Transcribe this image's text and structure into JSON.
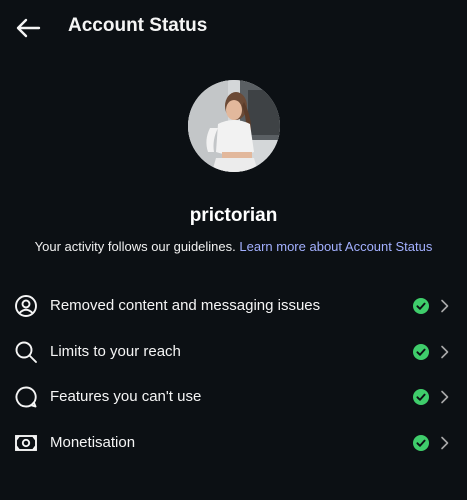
{
  "header": {
    "title": "Account Status",
    "back_icon": "arrow-left-icon"
  },
  "profile": {
    "username": "prictorian",
    "info_text": "Your activity follows our guidelines.",
    "learn_more_link": "Learn more about Account Status"
  },
  "items": [
    {
      "label": "Removed content and messaging issues",
      "icon": "person-circle-icon",
      "status": "ok"
    },
    {
      "label": "Limits to your reach",
      "icon": "magnifier-icon",
      "status": "ok"
    },
    {
      "label": "Features you can't use",
      "icon": "speech-bubble-icon",
      "status": "ok"
    },
    {
      "label": "Monetisation",
      "icon": "banknote-icon",
      "status": "ok"
    }
  ],
  "colors": {
    "background": "#0c1014",
    "text": "#f5f5f5",
    "link": "#a3b0ff",
    "status_ok": "#3fcd6b"
  }
}
